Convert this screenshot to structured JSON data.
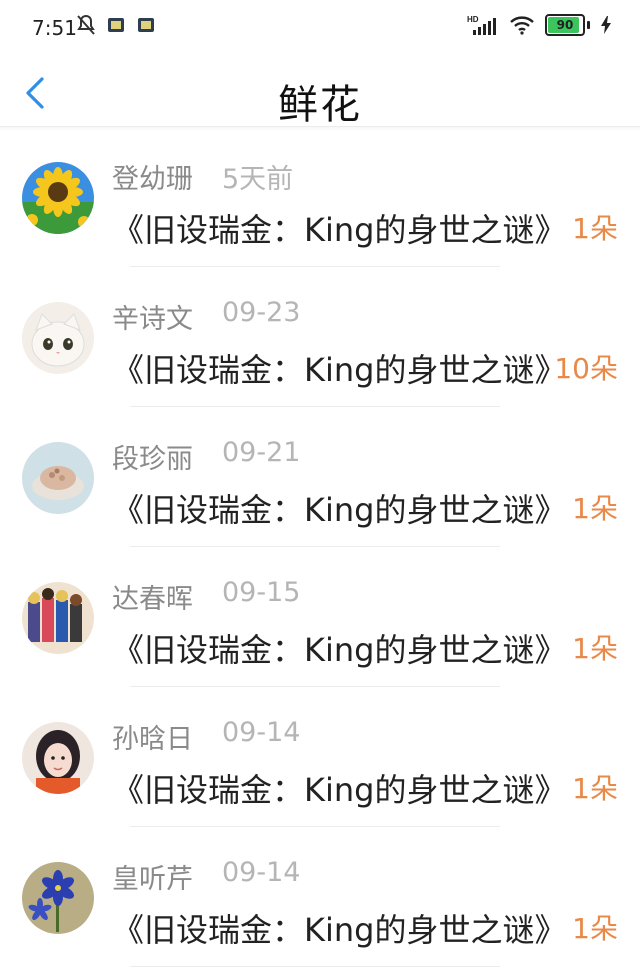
{
  "status": {
    "time": "7:51",
    "battery": "90",
    "battery_level": 0.9,
    "network": "HD"
  },
  "header": {
    "title": "鲜花"
  },
  "items": [
    {
      "name": "登幼珊",
      "time": "5天前",
      "text": "《旧设瑞金：King的身世之谜》",
      "count": "1朵",
      "avatar": "sunflower"
    },
    {
      "name": "辛诗文",
      "time": "09-23",
      "text": "《旧设瑞金：King的身世之谜》",
      "count": "10朵",
      "avatar": "cat"
    },
    {
      "name": "段珍丽",
      "time": "09-21",
      "text": "《旧设瑞金：King的身世之谜》",
      "count": "1朵",
      "avatar": "dessert"
    },
    {
      "name": "达春晖",
      "time": "09-15",
      "text": "《旧设瑞金：King的身世之谜》",
      "count": "1朵",
      "avatar": "anime-group"
    },
    {
      "name": "孙晗日",
      "time": "09-14",
      "text": "《旧设瑞金：King的身世之谜》",
      "count": "1朵",
      "avatar": "girl"
    },
    {
      "name": "皇听芹",
      "time": "09-14",
      "text": "《旧设瑞金：King的身世之谜》",
      "count": "1朵",
      "avatar": "blue-flower"
    }
  ],
  "colors": {
    "accent": "#2f8ee6",
    "count": "#e8894a",
    "name": "#8a8a8a",
    "time": "#b5b5b5"
  }
}
